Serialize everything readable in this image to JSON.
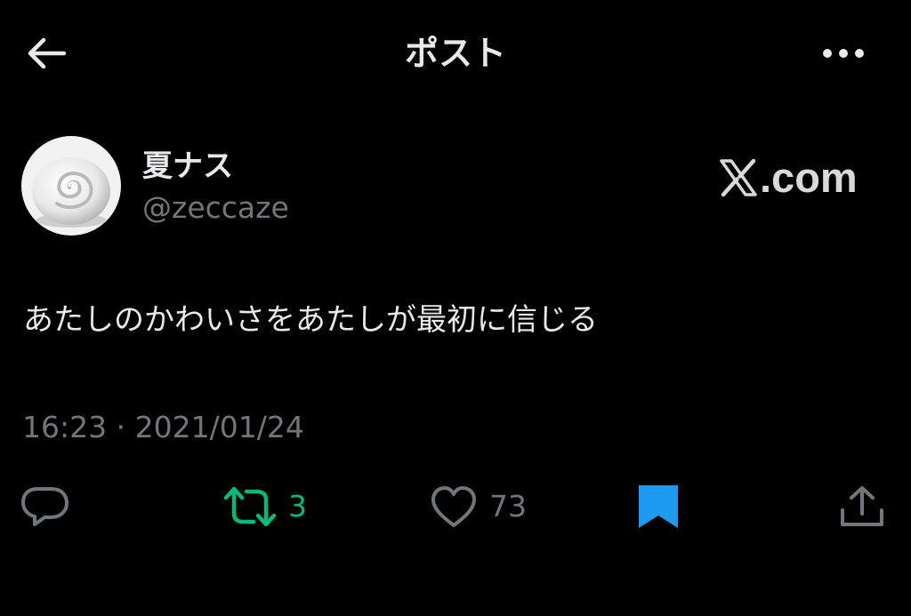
{
  "header": {
    "title": "ポスト",
    "back_icon": "arrow-left-icon",
    "more_icon": "more-horizontal-icon"
  },
  "author": {
    "display_name": "夏ナス",
    "handle": "@zeccaze",
    "avatar_icon": "white-swirl-avatar"
  },
  "watermark": {
    "logo_icon": "x-logo-icon",
    "text": ".com"
  },
  "post": {
    "text": "あたしのかわいさをあたしが最初に信じる",
    "time": "16:23",
    "separator": "·",
    "date": "2021/01/24"
  },
  "actions": {
    "reply": {
      "icon": "reply-bubble-icon"
    },
    "repost": {
      "icon": "repost-icon",
      "count": "3",
      "color": "#00ba7c"
    },
    "like": {
      "icon": "heart-outline-icon",
      "count": "73"
    },
    "bookmark": {
      "icon": "bookmark-filled-icon",
      "color": "#1d9bf0",
      "active": true
    },
    "share": {
      "icon": "share-upload-icon"
    }
  },
  "colors": {
    "background": "#000000",
    "text_primary": "#e7e9ea",
    "text_secondary": "#71767b",
    "repost_accent": "#00ba7c",
    "bookmark_accent": "#1d9bf0"
  }
}
